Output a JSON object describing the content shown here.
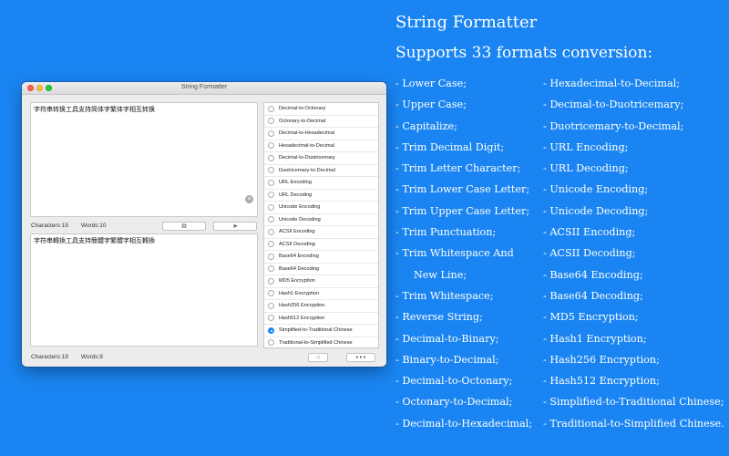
{
  "window": {
    "title": "String Formatter",
    "input_text": "字符串转换工具支持简体字繁体字相互转换",
    "output_text": "字符串轉換工具支持簡體字繁體字相互轉換",
    "input_stats": {
      "characters": "Characters:19",
      "words": "Words:10"
    },
    "output_stats": {
      "characters": "Characters:19",
      "words": "Words:9"
    },
    "clear_icon": "×",
    "copy_icon": "⧉",
    "send_icon": "➤",
    "hand_icon": "☝",
    "more_icon": "•••",
    "conversions": [
      {
        "label": "Decimal-to-Octonary",
        "selected": false
      },
      {
        "label": "Octonary-to-Decimal",
        "selected": false
      },
      {
        "label": "Decimal-to-Hexadecimal",
        "selected": false
      },
      {
        "label": "Hexadecimal-to-Decimal",
        "selected": false
      },
      {
        "label": "Decimal-to-Duotricemary",
        "selected": false
      },
      {
        "label": "Duotricemary-to-Decimal",
        "selected": false
      },
      {
        "label": "URL Encoding",
        "selected": false
      },
      {
        "label": "URL Decoding",
        "selected": false
      },
      {
        "label": "Unicode Encoding",
        "selected": false
      },
      {
        "label": "Unicode Decoding",
        "selected": false
      },
      {
        "label": "ACSII Encoding",
        "selected": false
      },
      {
        "label": "ACSII Decoding",
        "selected": false
      },
      {
        "label": "Base64 Encoding",
        "selected": false
      },
      {
        "label": "Base64 Decoding",
        "selected": false
      },
      {
        "label": "MD5 Encryption",
        "selected": false
      },
      {
        "label": "Hash1 Encryption",
        "selected": false
      },
      {
        "label": "Hash256 Encryption",
        "selected": false
      },
      {
        "label": "Hash512 Encryption",
        "selected": false
      },
      {
        "label": "Simplified-to-Traditional Chinese",
        "selected": true
      },
      {
        "label": "Traditional-to-Simplified Chinese",
        "selected": false
      }
    ]
  },
  "promo": {
    "title": "String Formatter",
    "subtitle": "Supports 33 formats conversion:",
    "left_column": [
      "- Lower Case;",
      "- Upper Case;",
      "- Capitalize;",
      "- Trim Decimal Digit;",
      "- Trim Letter Character;",
      "- Trim Lower Case Letter;",
      "- Trim Upper Case Letter;",
      "- Trim Punctuation;",
      "- Trim Whitespace And",
      "New Line;",
      "- Trim Whitespace;",
      "- Reverse String;",
      "- Decimal-to-Binary;",
      "- Binary-to-Decimal;",
      "- Decimal-to-Octonary;",
      "- Octonary-to-Decimal;",
      "- Decimal-to-Hexadecimal;"
    ],
    "right_column": [
      "- Hexadecimal-to-Decimal;",
      "- Decimal-to-Duotricemary;",
      "- Duotricemary-to-Decimal;",
      "- URL Encoding;",
      "- URL Decoding;",
      "- Unicode Encoding;",
      "- Unicode Decoding;",
      "- ACSII Encoding;",
      "- ACSII Decoding;",
      "- Base64 Encoding;",
      "- Base64 Decoding;",
      "- MD5 Encryption;",
      "- Hash1 Encryption;",
      "- Hash256 Encryption;",
      "- Hash512 Encryption;",
      "- Simplified-to-Traditional Chinese;",
      "- Traditional-to-Simplified Chinese."
    ]
  },
  "colors": {
    "background": "#1a85f2",
    "selected_radio": "#1a85f2",
    "window": "#ececec"
  }
}
